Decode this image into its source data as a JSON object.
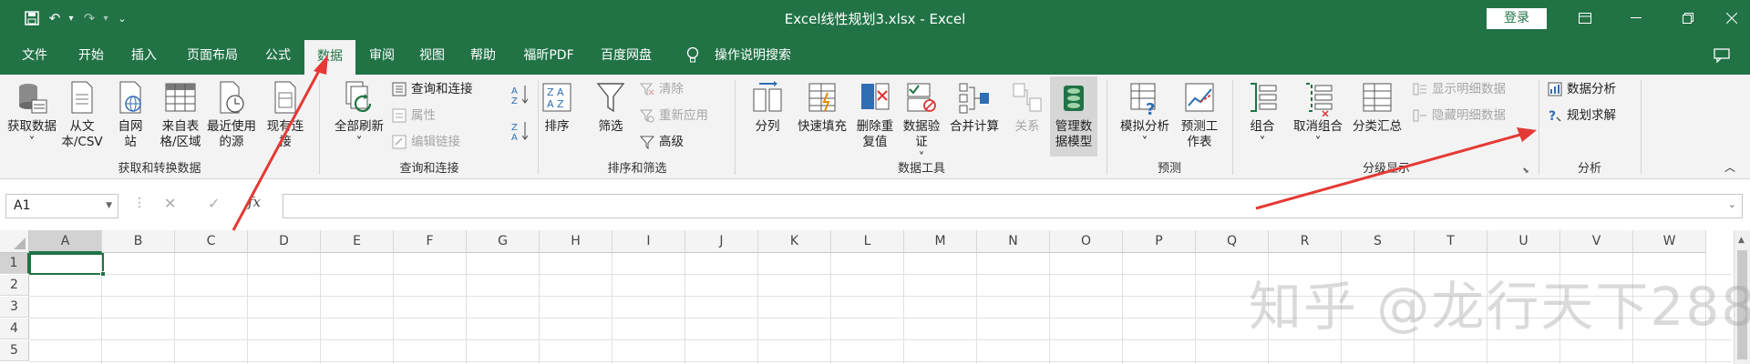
{
  "titlebar": {
    "title": "Excel线性规划3.xlsx - Excel",
    "login": "登录"
  },
  "tabs": [
    "文件",
    "开始",
    "插入",
    "页面布局",
    "公式",
    "数据",
    "审阅",
    "视图",
    "帮助",
    "福昕PDF",
    "百度网盘",
    "操作说明搜索"
  ],
  "ribbon": {
    "get_data": "获取数据",
    "from_text_csv": "从文本/CSV",
    "from_web": "自网站",
    "from_table": "来自表格/区域",
    "recent_sources": "最近使用的源",
    "existing_conn": "现有连接",
    "group_get": "获取和转换数据",
    "refresh_all": "全部刷新",
    "queries_conn": "查询和连接",
    "properties": "属性",
    "edit_links": "编辑链接",
    "group_query": "查询和连接",
    "sort": "排序",
    "filter": "筛选",
    "clear": "清除",
    "reapply": "重新应用",
    "advanced": "高级",
    "group_sort": "排序和筛选",
    "text_to_cols": "分列",
    "flash_fill": "快速填充",
    "remove_dup": "删除重复值",
    "data_valid": "数据验证",
    "consolidate": "合并计算",
    "relations": "关系",
    "manage_model": "管理数据模型",
    "group_tools": "数据工具",
    "what_if": "模拟分析",
    "forecast_sheet": "预测工作表",
    "group_forecast": "预测",
    "group_btn": "组合",
    "ungroup": "取消组合",
    "subtotal": "分类汇总",
    "show_detail": "显示明细数据",
    "hide_detail": "隐藏明细数据",
    "group_outline": "分级显示",
    "data_analysis": "数据分析",
    "solver": "规划求解",
    "group_analysis": "分析"
  },
  "formula_bar": {
    "name_box": "A1",
    "fx": "fx"
  },
  "columns": [
    "A",
    "B",
    "C",
    "D",
    "E",
    "F",
    "G",
    "H",
    "I",
    "J",
    "K",
    "L",
    "M",
    "N",
    "O",
    "P",
    "Q",
    "R",
    "S",
    "T",
    "U",
    "V",
    "W"
  ],
  "rows": [
    "1",
    "2",
    "3",
    "4",
    "5"
  ],
  "watermark": "知乎 @龙行天下288",
  "colors": {
    "brand": "#217346",
    "annotation": "#e53935"
  }
}
